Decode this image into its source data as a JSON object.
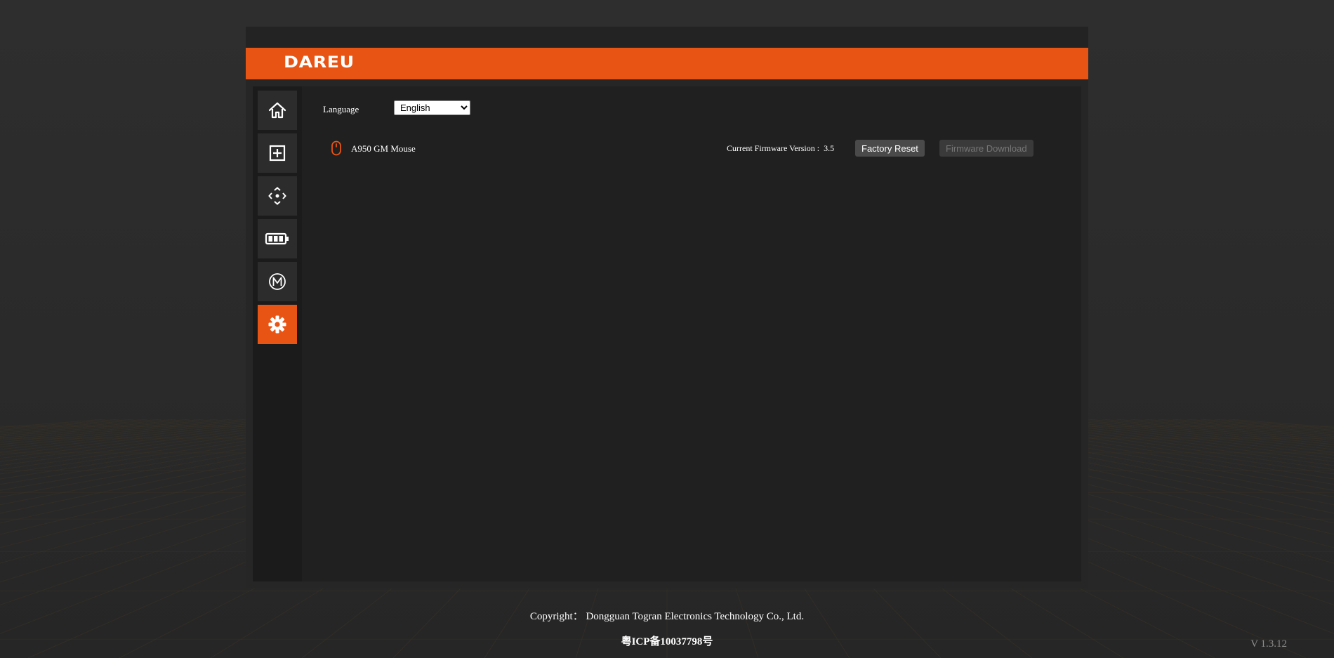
{
  "brand": {
    "logo_text": "DAREU",
    "accent_color": "#e85414"
  },
  "sidebar": {
    "items": [
      {
        "name": "home",
        "icon": "home-icon",
        "active": false
      },
      {
        "name": "add",
        "icon": "plus-square-icon",
        "active": false
      },
      {
        "name": "move",
        "icon": "move-arrows-icon",
        "active": false
      },
      {
        "name": "battery",
        "icon": "battery-icon",
        "active": false
      },
      {
        "name": "macro",
        "icon": "macro-m-icon",
        "active": false
      },
      {
        "name": "settings",
        "icon": "gear-icon",
        "active": true
      }
    ]
  },
  "settings": {
    "language_label": "Language",
    "language_selected": "English",
    "language_options": [
      "English"
    ],
    "device_name": "A950 GM Mouse",
    "firmware_label": "Current Firmware Version :  3.5",
    "factory_reset_label": "Factory Reset",
    "firmware_download_label": "Firmware Download"
  },
  "footer": {
    "copyright": "Copyright： Dongguan Togran Electronics Technology Co., Ltd.",
    "icp": "粤ICP备10037798号",
    "version": "V 1.3.12"
  }
}
